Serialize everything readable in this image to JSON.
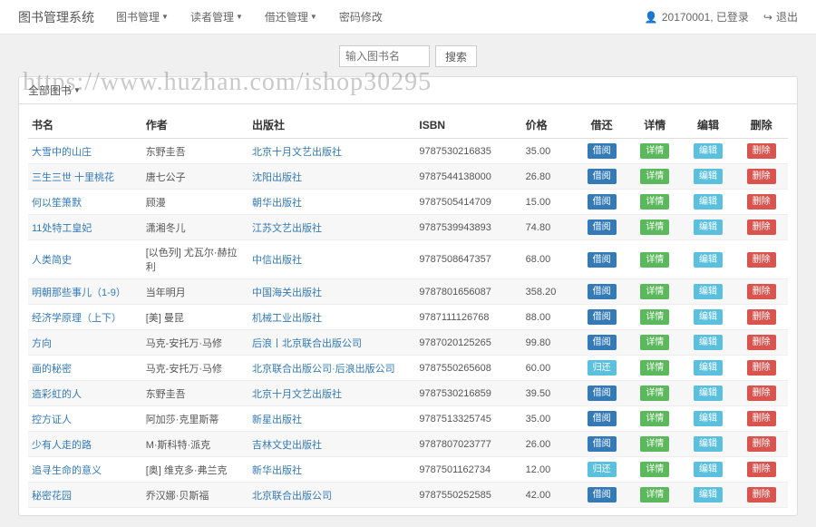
{
  "navbar": {
    "brand": "图书管理系统",
    "menu": [
      {
        "label": "图书管理",
        "hasDropdown": true
      },
      {
        "label": "读者管理",
        "hasDropdown": true
      },
      {
        "label": "借还管理",
        "hasDropdown": true
      },
      {
        "label": "密码修改",
        "hasDropdown": false
      }
    ],
    "user_icon": "👤",
    "user_text": "20170001, 已登录",
    "logout_icon": "↪",
    "logout_text": "退出"
  },
  "search": {
    "placeholder": "输入图书名",
    "button": "搜索"
  },
  "panel": {
    "title": "全部图书"
  },
  "watermark": "https://www.huzhan.com/ishop30295",
  "table": {
    "headers": {
      "title": "书名",
      "author": "作者",
      "publisher": "出版社",
      "isbn": "ISBN",
      "price": "价格",
      "borrow": "借还",
      "detail": "详情",
      "edit": "编辑",
      "delete": "删除"
    },
    "action_labels": {
      "borrow": "借阅",
      "return": "归还",
      "detail": "详情",
      "edit": "编辑",
      "delete": "删除"
    },
    "rows": [
      {
        "title": "大雪中的山庄",
        "author": "东野圭吾",
        "publisher": "北京十月文艺出版社",
        "isbn": "9787530216835",
        "price": "35.00",
        "borrow_state": "borrow"
      },
      {
        "title": "三生三世 十里桃花",
        "author": "唐七公子",
        "publisher": "沈阳出版社",
        "isbn": "9787544138000",
        "price": "26.80",
        "borrow_state": "borrow"
      },
      {
        "title": "何以笙箫默",
        "author": "顾漫",
        "publisher": "朝华出版社",
        "isbn": "9787505414709",
        "price": "15.00",
        "borrow_state": "borrow"
      },
      {
        "title": "11处特工皇妃",
        "author": "潇湘冬儿",
        "publisher": "江苏文艺出版社",
        "isbn": "9787539943893",
        "price": "74.80",
        "borrow_state": "borrow"
      },
      {
        "title": "人类简史",
        "author": "[以色列] 尤瓦尔·赫拉利",
        "publisher": "中信出版社",
        "isbn": "9787508647357",
        "price": "68.00",
        "borrow_state": "borrow"
      },
      {
        "title": "明朝那些事儿（1-9）",
        "author": "当年明月",
        "publisher": "中国海关出版社",
        "isbn": "9787801656087",
        "price": "358.20",
        "borrow_state": "borrow"
      },
      {
        "title": "经济学原理（上下）",
        "author": "[美] 曼昆",
        "publisher": "机械工业出版社",
        "isbn": "9787111126768",
        "price": "88.00",
        "borrow_state": "borrow"
      },
      {
        "title": "方向",
        "author": "马克-安托万·马修",
        "publisher": "后浪丨北京联合出版公司",
        "isbn": "9787020125265",
        "price": "99.80",
        "borrow_state": "borrow"
      },
      {
        "title": "画的秘密",
        "author": "马克-安托万·马修",
        "publisher": "北京联合出版公司·后浪出版公司",
        "isbn": "9787550265608",
        "price": "60.00",
        "borrow_state": "return"
      },
      {
        "title": "造彩虹的人",
        "author": "东野圭吾",
        "publisher": "北京十月文艺出版社",
        "isbn": "9787530216859",
        "price": "39.50",
        "borrow_state": "borrow"
      },
      {
        "title": "控方证人",
        "author": "阿加莎·克里斯蒂",
        "publisher": "新星出版社",
        "isbn": "9787513325745",
        "price": "35.00",
        "borrow_state": "borrow"
      },
      {
        "title": "少有人走的路",
        "author": "M·斯科特·派克",
        "publisher": "吉林文史出版社",
        "isbn": "9787807023777",
        "price": "26.00",
        "borrow_state": "borrow"
      },
      {
        "title": "追寻生命的意义",
        "author": "[奥] 维克多·弗兰克",
        "publisher": "新华出版社",
        "isbn": "9787501162734",
        "price": "12.00",
        "borrow_state": "return"
      },
      {
        "title": "秘密花园",
        "author": "乔汉娜·贝斯福",
        "publisher": "北京联合出版公司",
        "isbn": "9787550252585",
        "price": "42.00",
        "borrow_state": "borrow"
      }
    ]
  }
}
